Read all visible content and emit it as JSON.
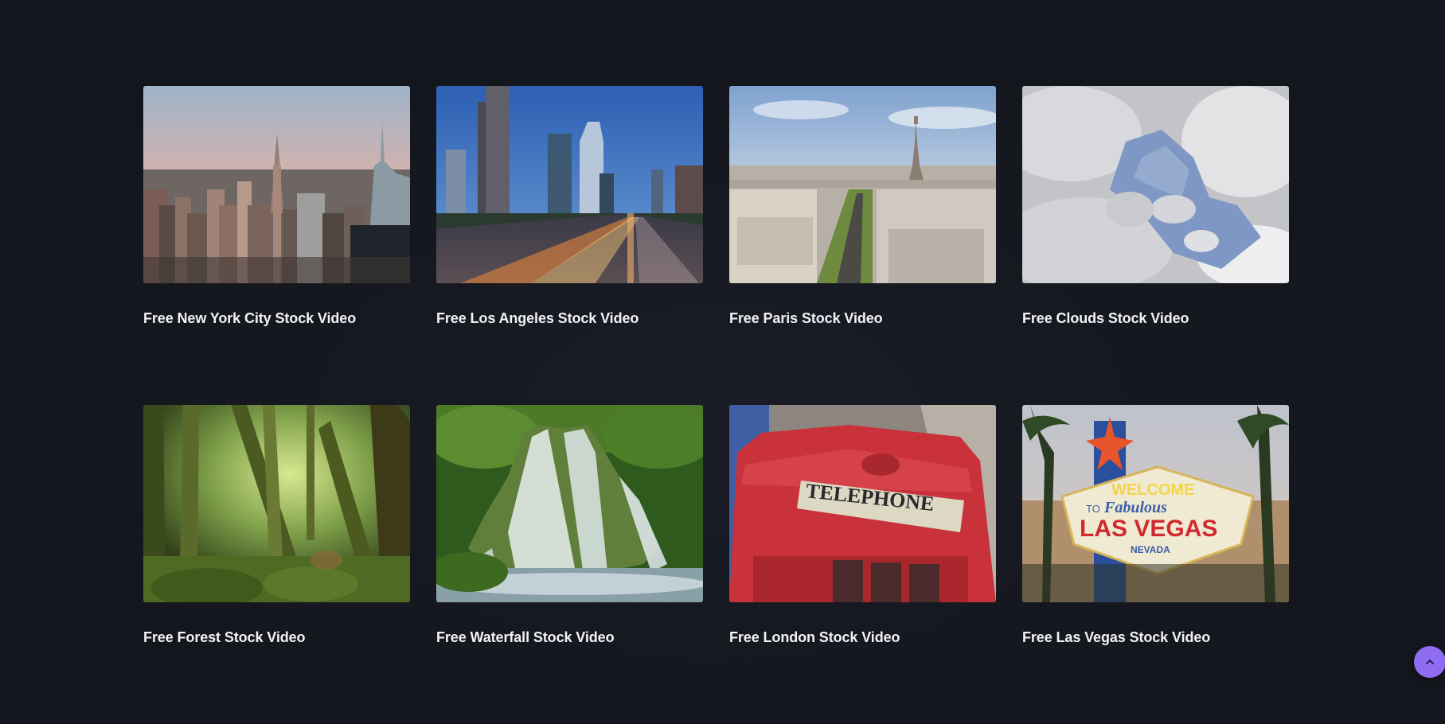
{
  "cards": [
    {
      "title": "Free New York City Stock Video",
      "image": "new-york-city-skyline"
    },
    {
      "title": "Free Los Angeles Stock Video",
      "image": "los-angeles-freeway"
    },
    {
      "title": "Free Paris Stock Video",
      "image": "paris-eiffel-tower"
    },
    {
      "title": "Free Clouds Stock Video",
      "image": "clouds-sky"
    },
    {
      "title": "Free Forest Stock Video",
      "image": "mossy-forest"
    },
    {
      "title": "Free Waterfall Stock Video",
      "image": "waterfall"
    },
    {
      "title": "Free London Stock Video",
      "image": "red-telephone-box"
    },
    {
      "title": "Free Las Vegas Stock Video",
      "image": "las-vegas-sign"
    }
  ],
  "images": {
    "telephone_sign": "TELEPHONE",
    "vegas_welcome": "WELCOME",
    "vegas_to": "TO",
    "vegas_fabulous": "Fabulous",
    "vegas_city": "LAS VEGAS",
    "vegas_state": "NEVADA"
  },
  "scroll_top": {
    "icon": "chevron-up-icon"
  },
  "colors": {
    "accent": "#8f6cf2",
    "background": "#15171f"
  }
}
